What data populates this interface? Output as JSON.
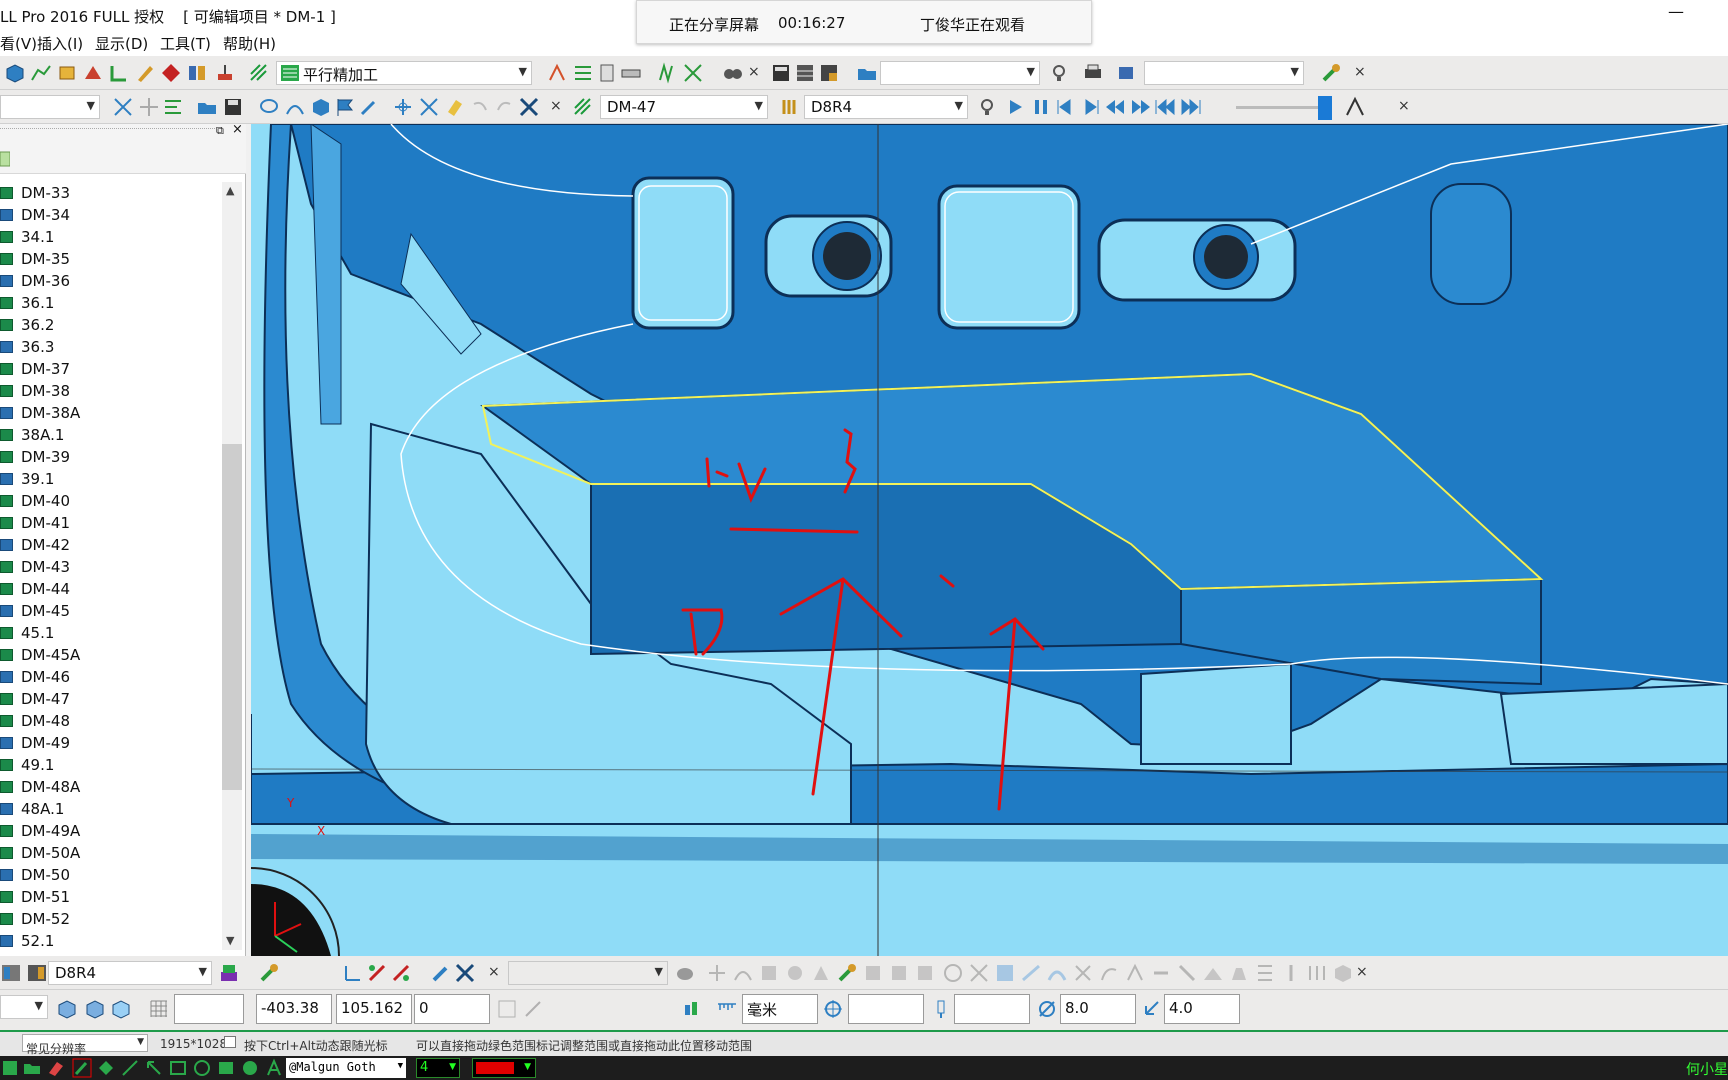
{
  "titlebar": {
    "title": "LL Pro 2016 FULL 授权    [ 可编辑项目 * DM-1 ]",
    "minimize": "—"
  },
  "share_banner": {
    "status": "正在分享屏幕",
    "timer": "00:16:27",
    "viewer": "丁俊华正在观看"
  },
  "menu": [
    "看(V)",
    "插入(I)",
    "显示(D)",
    "工具(T)",
    "帮助(H)"
  ],
  "toolbar1": {
    "strategy_select": "平行精加工"
  },
  "toolbar2": {
    "model_select": "DM-47",
    "tool_select": "D8R4"
  },
  "tree": {
    "items": [
      {
        "label": "DM-33",
        "icon": "toolpath-icon"
      },
      {
        "label": "DM-34",
        "icon": "toolpath-icon"
      },
      {
        "label": "34.1",
        "icon": "toolpath-icon"
      },
      {
        "label": "DM-35",
        "icon": "toolpath-icon"
      },
      {
        "label": "DM-36",
        "icon": "toolpath-icon"
      },
      {
        "label": "36.1",
        "icon": "toolpath-icon"
      },
      {
        "label": "36.2",
        "icon": "toolpath-icon"
      },
      {
        "label": "36.3",
        "icon": "toolpath-icon"
      },
      {
        "label": "DM-37",
        "icon": "toolpath-icon"
      },
      {
        "label": "DM-38",
        "icon": "toolpath-icon"
      },
      {
        "label": "DM-38A",
        "icon": "toolpath-icon"
      },
      {
        "label": "38A.1",
        "icon": "toolpath-icon"
      },
      {
        "label": "DM-39",
        "icon": "toolpath-icon"
      },
      {
        "label": "39.1",
        "icon": "toolpath-icon"
      },
      {
        "label": "DM-40",
        "icon": "toolpath-icon"
      },
      {
        "label": "DM-41",
        "icon": "toolpath-icon"
      },
      {
        "label": "DM-42",
        "icon": "toolpath-icon"
      },
      {
        "label": "DM-43",
        "icon": "toolpath-icon"
      },
      {
        "label": "DM-44",
        "icon": "toolpath-icon"
      },
      {
        "label": "DM-45",
        "icon": "toolpath-icon"
      },
      {
        "label": "45.1",
        "icon": "toolpath-icon"
      },
      {
        "label": "DM-45A",
        "icon": "toolpath-icon"
      },
      {
        "label": "DM-46",
        "icon": "toolpath-icon"
      },
      {
        "label": "DM-47",
        "icon": "toolpath-icon"
      },
      {
        "label": "DM-48",
        "icon": "toolpath-icon"
      },
      {
        "label": "DM-49",
        "icon": "toolpath-icon"
      },
      {
        "label": "49.1",
        "icon": "toolpath-icon"
      },
      {
        "label": "DM-48A",
        "icon": "toolpath-icon"
      },
      {
        "label": "48A.1",
        "icon": "toolpath-icon"
      },
      {
        "label": "DM-49A",
        "icon": "toolpath-icon"
      },
      {
        "label": "DM-50A",
        "icon": "toolpath-icon"
      },
      {
        "label": "DM-50",
        "icon": "toolpath-icon"
      },
      {
        "label": "DM-51",
        "icon": "toolpath-icon"
      },
      {
        "label": "DM-52",
        "icon": "toolpath-icon"
      },
      {
        "label": "52.1",
        "icon": "toolpath-icon"
      }
    ]
  },
  "viewport": {
    "axis_y": "Y",
    "axis_x": "X"
  },
  "bottombar": {
    "tool_select": "D8R4"
  },
  "coordbar": {
    "x": "-403.38",
    "y": "105.162",
    "z": "0",
    "units": "毫米",
    "diameter": "8.0",
    "corner": "4.0"
  },
  "statusbar": {
    "resolution_select": "常见分辨率",
    "resolution": "1915*1028",
    "hint1": "按下Ctrl+Alt动态跟随光标",
    "hint2": "可以直接拖动绿色范围标记调整范围或直接拖动此位置移动范围"
  },
  "taskstrip": {
    "font": "@Malgun Goth",
    "size": "4",
    "user": "何小星"
  },
  "colors": {
    "model_blue": "#1f7bc4",
    "background_cyan": "#8fdcf7",
    "annotation_red": "#e01010",
    "toolpath_yellow": "#f2f25a"
  }
}
